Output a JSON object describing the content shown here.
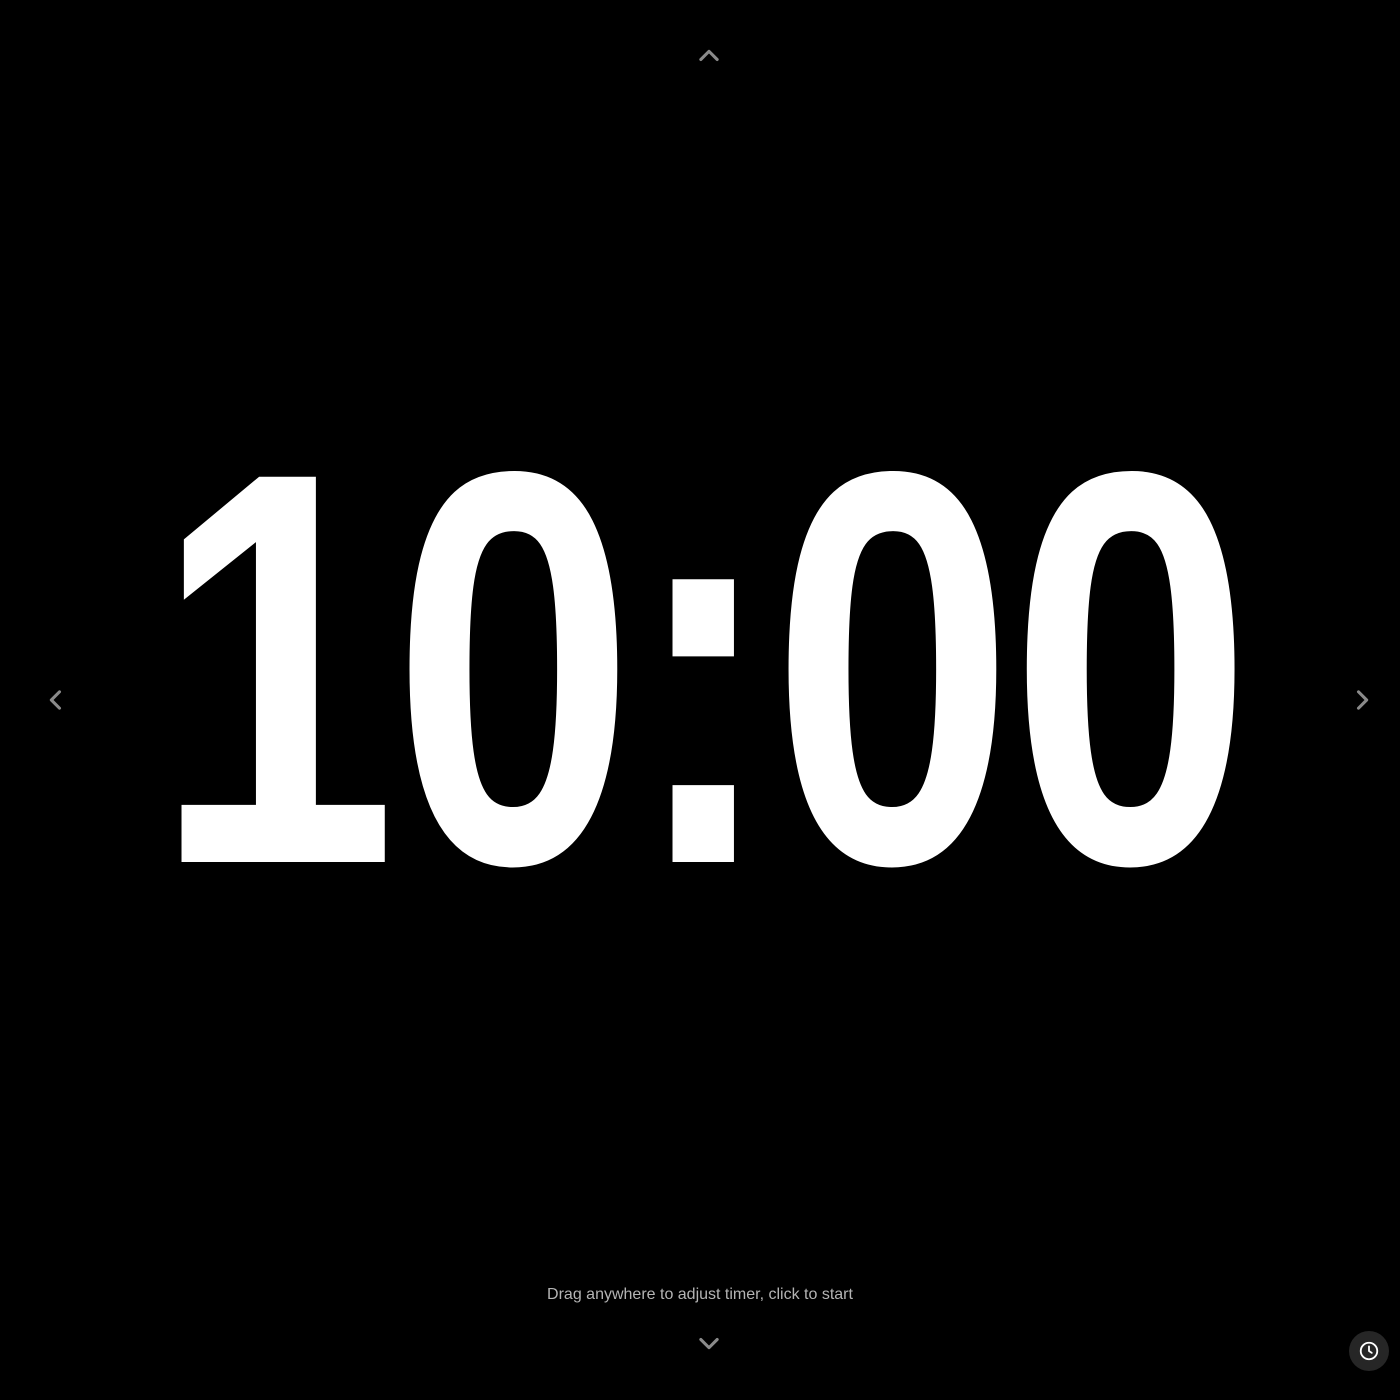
{
  "timer": {
    "display": "10:00"
  },
  "hint": {
    "text": "Drag anywhere to adjust timer, click to start"
  },
  "controls": {
    "up_icon": "chevron-up-icon",
    "down_icon": "chevron-down-icon",
    "left_icon": "chevron-left-icon",
    "right_icon": "chevron-right-icon",
    "history_icon": "clock-icon"
  },
  "colors": {
    "background": "#000000",
    "timer_text": "#ffffff",
    "hint_text": "#b4b4b4",
    "arrow": "#8a8a8a",
    "history_button_bg": "#262626"
  }
}
